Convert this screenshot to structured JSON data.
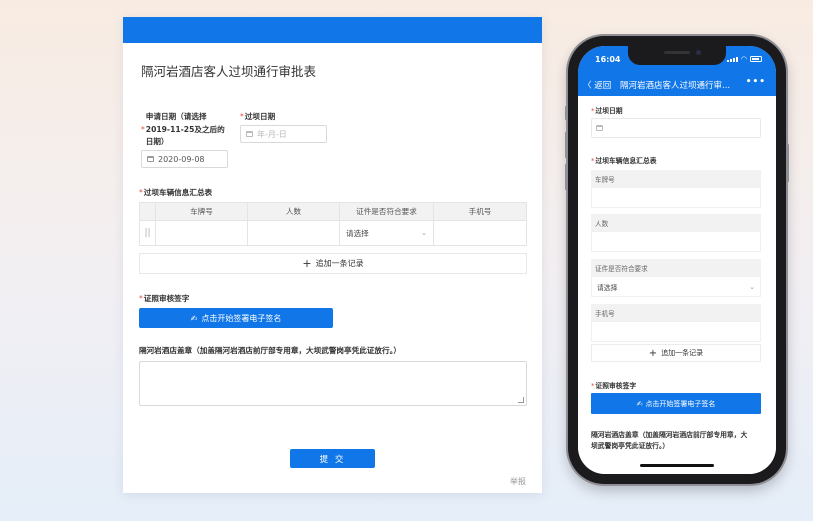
{
  "desktop": {
    "title": "隔河岩酒店客人过坝通行审批表",
    "apply_date": {
      "label": "申请日期（请选择2019-11-25及之后的日期）",
      "label_lines": [
        "申请日期（请选择",
        "2019-11-25及之后的",
        "日期）"
      ],
      "value": "2020-09-08"
    },
    "pass_date": {
      "label": "过坝日期",
      "placeholder": "年-月-日"
    },
    "vehicle_table": {
      "label": "过坝车辆信息汇总表",
      "columns": [
        "车牌号",
        "人数",
        "证件是否符合要求",
        "手机号"
      ],
      "row": {
        "select_placeholder": "请选择"
      },
      "add_label": "追加一条记录"
    },
    "signature": {
      "label": "证照审核签字",
      "button": "点击开始签署电子签名"
    },
    "stamp_label": "隔河岩酒店盖章（加盖隔河岩酒店前厅部专用章，大坝武警岗亭凭此证放行。）",
    "submit": "提 交",
    "report": "举报"
  },
  "phone": {
    "time": "16:04",
    "back": "〈 返回",
    "title": "隔河岩酒店客人过坝通行审...",
    "more": "•••",
    "pass_date_label": "过坝日期",
    "vehicle_label": "过坝车辆信息汇总表",
    "fields": {
      "plate": "车牌号",
      "people": "人数",
      "cert": "证件是否符合要求",
      "cert_select": "请选择",
      "phone": "手机号"
    },
    "add_label": "追加一条记录",
    "signature_label": "证照审核签字",
    "signature_button": "点击开始签署电子签名",
    "stamp_lines": [
      "隔河岩酒店盖章（加盖隔河岩酒店前厅部专用章，大",
      "坝武警岗亭凭此证放行。）"
    ]
  },
  "colors": {
    "primary": "#1177e8",
    "required": "#e8483f"
  }
}
